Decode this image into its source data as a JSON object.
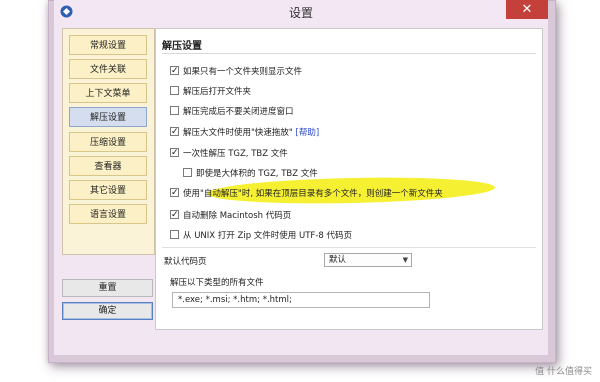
{
  "window": {
    "title": "设置",
    "close_glyph": "✕"
  },
  "sidebar": {
    "items": [
      {
        "label": "常规设置",
        "active": false
      },
      {
        "label": "文件关联",
        "active": false
      },
      {
        "label": "上下文菜单",
        "active": false
      },
      {
        "label": "解压设置",
        "active": true
      },
      {
        "label": "压缩设置",
        "active": false
      },
      {
        "label": "查看器",
        "active": false
      },
      {
        "label": "其它设置",
        "active": false
      },
      {
        "label": "语言设置",
        "active": false
      }
    ],
    "reset_label": "重置",
    "ok_label": "确定"
  },
  "panel": {
    "section_title": "解压设置",
    "options": [
      {
        "label": "如果只有一个文件夹则显示文件",
        "checked": true
      },
      {
        "label": "解压后打开文件夹",
        "checked": false
      },
      {
        "label": "解压完成后不要关闭进度窗口",
        "checked": false
      },
      {
        "label": "解压大文件时使用\"快速拖放\"",
        "link": "[帮助]",
        "checked": true
      },
      {
        "label": "一次性解压 TGZ, TBZ 文件",
        "checked": true
      },
      {
        "label": "即使是大体积的 TGZ, TBZ 文件",
        "checked": false
      },
      {
        "label": "使用\"自动解压\"时, 如果在顶层目录有多个文件，则创建一个新文件夹",
        "checked": true
      },
      {
        "label": "自动删除 Macintosh 代码页",
        "checked": true
      },
      {
        "label": "从 UNIX 打开 Zip 文件时使用 UTF-8 代码页",
        "checked": false
      }
    ],
    "codepage_label": "默认代码页",
    "codepage_value": "默认",
    "types_label": "解压以下类型的所有文件",
    "types_value": "*.exe; *.msi; *.htm; *.html;"
  },
  "watermark": "值 什么值得买",
  "colors": {
    "highlight": "#f6f033",
    "close_button": "#c4403a",
    "window_bg": "#f2e6f2"
  }
}
